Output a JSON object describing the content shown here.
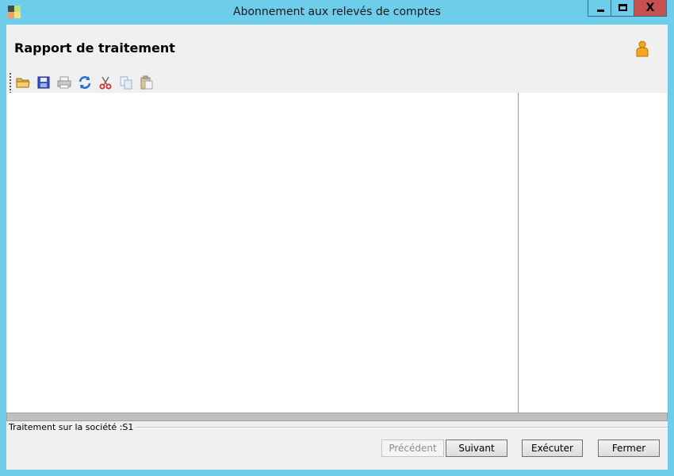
{
  "window": {
    "title": "Abonnement aux relevés de comptes",
    "controls": {
      "minimize_icon": "minimize-icon",
      "maximize_icon": "maximize-icon",
      "close_icon": "close-icon",
      "close_glyph": "X"
    },
    "frame_color": "#6fcdec",
    "close_color": "#c75050"
  },
  "header": {
    "title": "Rapport de traitement",
    "user_icon": "user-icon"
  },
  "toolbar": {
    "items": [
      {
        "icon": "open-folder-icon",
        "enabled": true
      },
      {
        "icon": "save-icon",
        "enabled": true
      },
      {
        "icon": "print-icon",
        "enabled": false
      },
      {
        "icon": "refresh-icon",
        "enabled": true
      },
      {
        "icon": "cut-icon",
        "enabled": true
      },
      {
        "icon": "copy-icon",
        "enabled": false
      },
      {
        "icon": "paste-icon",
        "enabled": false
      }
    ]
  },
  "status": {
    "label": "Traitement sur la société :S1"
  },
  "buttons": {
    "previous": "Précédent",
    "next": "Suivant",
    "execute": "Exécuter",
    "close": "Fermer"
  }
}
